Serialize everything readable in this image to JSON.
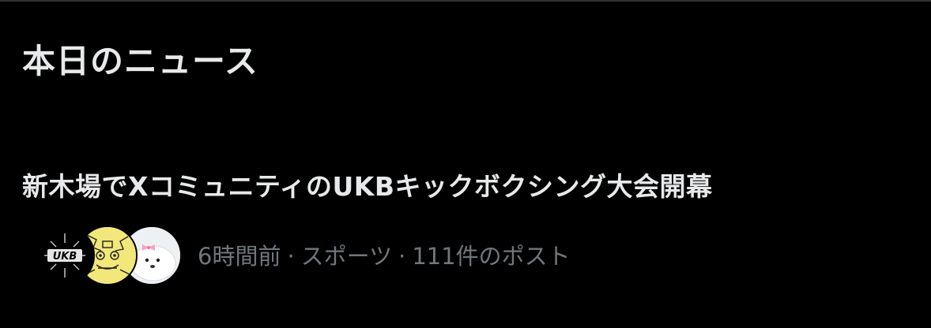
{
  "section": {
    "title": "本日のニュース"
  },
  "news_item": {
    "headline": "新木場でXコミュニティのUKBキックボクシング大会開幕",
    "time_ago": "6時間前",
    "category": "スポーツ",
    "post_count": "111件のポスト",
    "separator": "·",
    "avatars": [
      {
        "label": "UKB"
      },
      {
        "icon": "character-avatar"
      },
      {
        "icon": "seal-avatar"
      }
    ]
  },
  "colors": {
    "background": "#000000",
    "primary_text": "#e7e9ea",
    "secondary_text": "#71767b",
    "divider": "#2f3336"
  }
}
